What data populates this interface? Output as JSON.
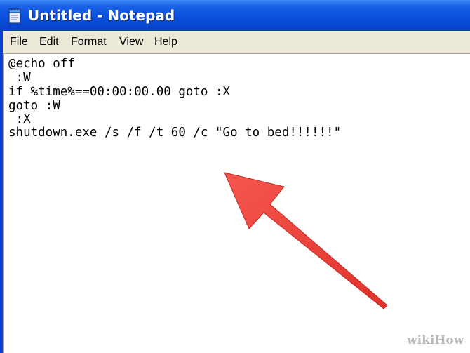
{
  "window": {
    "title": "Untitled - Notepad",
    "app_icon": "notepad-icon"
  },
  "menubar": {
    "items": [
      "File",
      "Edit",
      "Format",
      "View",
      "Help"
    ]
  },
  "editor": {
    "lines": [
      "@echo off",
      " :W",
      "if %time%==00:00:00.00 goto :X",
      "goto :W",
      " :X",
      "shutdown.exe /s /f /t 60 /c \"Go to bed!!!!!!\""
    ]
  },
  "annotation": {
    "arrow_color": "#ee3b34"
  },
  "watermark": {
    "text": "wikiHow"
  }
}
